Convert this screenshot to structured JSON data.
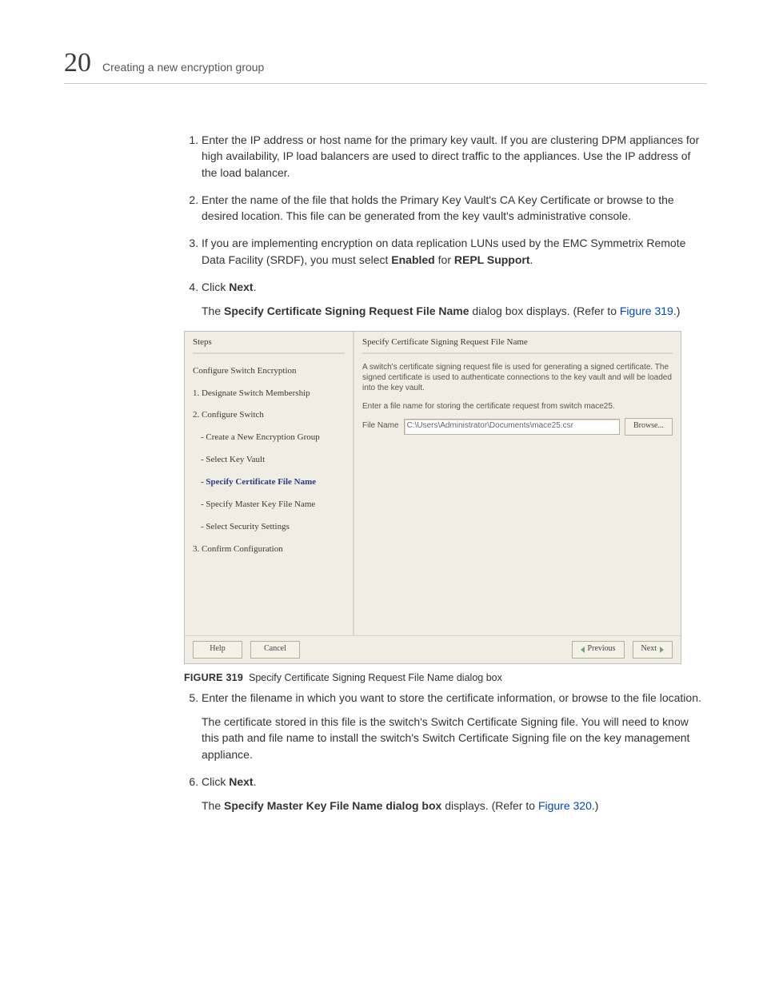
{
  "header": {
    "chapter_number": "20",
    "title": "Creating a new encryption group"
  },
  "body": {
    "step1": "Enter the IP address or host name for the primary key vault. If you are clustering DPM appliances for high availability, IP load balancers are used to direct traffic to the appliances. Use the IP address of the load balancer.",
    "step2": "Enter the name of the file that holds the Primary Key Vault's CA Key Certificate or browse to the desired location. This file can be generated from the key vault's administrative console.",
    "step3_a": "If you are implementing encryption on data replication LUNs used by the EMC Symmetrix Remote Data Facility (SRDF), you must select ",
    "step3_enabled": "Enabled",
    "step3_for": " for ",
    "step3_repl": "REPL Support",
    "step4_click": "Click ",
    "next_label": "Next",
    "step4_sub_a": "The ",
    "step4_sub_bold": "Specify Certificate Signing Request File Name",
    "step4_sub_b": " dialog box displays. (Refer to ",
    "fig319_ref": "Figure 319",
    "paren_close": ".)",
    "fig319_label": "FIGURE 319",
    "fig319_caption": "Specify Certificate Signing Request File Name dialog box",
    "step5": "Enter the filename in which you want to store the certificate information, or browse to the file location.",
    "step5_sub": "The certificate stored in this file is the switch's Switch Certificate Signing file. You will need to know this path and file name to install the switch's Switch Certificate Signing file on the key management appliance.",
    "step6_click": "Click ",
    "step6_sub_a": "The ",
    "step6_sub_bold": "Specify Master Key File Name dialog box",
    "step6_sub_b": " displays. (Refer to ",
    "fig320_ref": "Figure 320"
  },
  "dialog": {
    "steps_header": "Steps",
    "l1": "Configure Switch Encryption",
    "l2": "1. Designate Switch Membership",
    "l3": "2. Configure Switch",
    "l4": "- Create a New Encryption Group",
    "l5": "- Select Key Vault",
    "l6": "- Specify Certificate File Name",
    "l7": "- Specify Master Key File Name",
    "l8": "- Select Security Settings",
    "l9": "3. Confirm Configuration",
    "right_header": "Specify Certificate Signing Request File Name",
    "desc1": "A switch's certificate signing request file is used for generating a signed certificate. The signed certificate is used to authenticate connections to the key vault and will be loaded into the key vault.",
    "desc2": "Enter a file name for storing the certificate request from switch mace25.",
    "file_name_label": "File Name",
    "file_name_value": "C:\\Users\\Administrator\\Documents\\mace25.csr",
    "browse": "Browse...",
    "help": "Help",
    "cancel": "Cancel",
    "previous": "Previous",
    "next": "Next"
  }
}
